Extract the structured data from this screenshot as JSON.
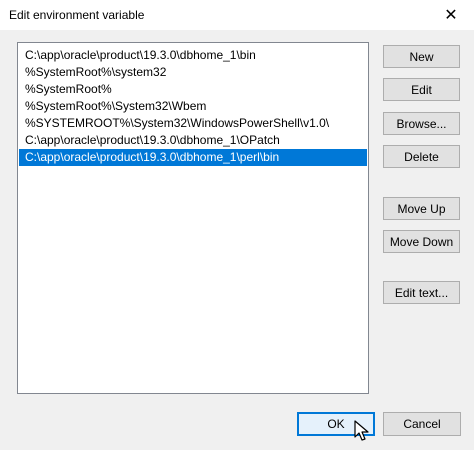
{
  "window": {
    "title": "Edit environment variable",
    "close_glyph": "✕"
  },
  "list": {
    "items": [
      {
        "text": "C:\\app\\oracle\\product\\19.3.0\\dbhome_1\\bin",
        "selected": false
      },
      {
        "text": "%SystemRoot%\\system32",
        "selected": false
      },
      {
        "text": "%SystemRoot%",
        "selected": false
      },
      {
        "text": "%SystemRoot%\\System32\\Wbem",
        "selected": false
      },
      {
        "text": "%SYSTEMROOT%\\System32\\WindowsPowerShell\\v1.0\\",
        "selected": false
      },
      {
        "text": "C:\\app\\oracle\\product\\19.3.0\\dbhome_1\\OPatch",
        "selected": false
      },
      {
        "text": "C:\\app\\oracle\\product\\19.3.0\\dbhome_1\\perl\\bin",
        "selected": true
      }
    ],
    "selected_bg": "#0078d7"
  },
  "buttons": {
    "new": "New",
    "edit": "Edit",
    "browse": "Browse...",
    "delete": "Delete",
    "move_up": "Move Up",
    "move_down": "Move Down",
    "edit_text": "Edit text...",
    "ok": "OK",
    "cancel": "Cancel"
  },
  "icons": {
    "close": "close-icon",
    "cursor": "mouse-pointer-icon"
  }
}
